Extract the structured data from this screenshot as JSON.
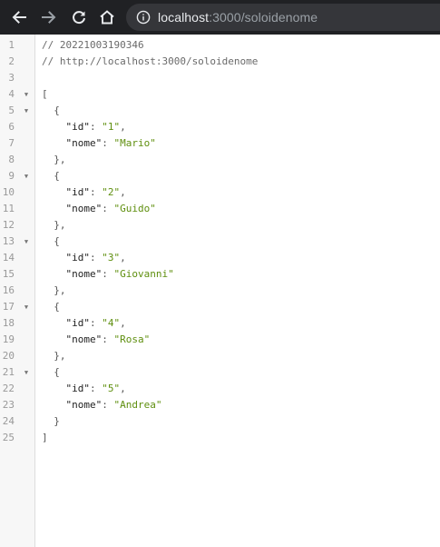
{
  "browser": {
    "url_host": "localhost",
    "url_rest": ":3000/soloidenome",
    "icons": {
      "back": "back-arrow-icon",
      "forward": "forward-arrow-icon",
      "reload": "reload-icon",
      "home": "home-icon",
      "info": "site-info-icon"
    }
  },
  "viewer": {
    "lines": [
      {
        "n": "1",
        "fold": "",
        "type": "comment",
        "indent": "",
        "text": "// 20221003190346"
      },
      {
        "n": "2",
        "fold": "",
        "type": "comment",
        "indent": "",
        "text": "// http://localhost:3000/soloidenome"
      },
      {
        "n": "3",
        "fold": "",
        "type": "blank",
        "indent": "",
        "text": ""
      },
      {
        "n": "4",
        "fold": "▼",
        "type": "punct",
        "indent": "",
        "text": "["
      },
      {
        "n": "5",
        "fold": "▼",
        "type": "punct",
        "indent": "  ",
        "text": "{"
      },
      {
        "n": "6",
        "fold": "",
        "type": "kv",
        "indent": "    ",
        "key": "\"id\"",
        "value": "\"1\"",
        "comma": true
      },
      {
        "n": "7",
        "fold": "",
        "type": "kv",
        "indent": "    ",
        "key": "\"nome\"",
        "value": "\"Mario\"",
        "comma": false
      },
      {
        "n": "8",
        "fold": "",
        "type": "punct",
        "indent": "  ",
        "text": "},"
      },
      {
        "n": "9",
        "fold": "▼",
        "type": "punct",
        "indent": "  ",
        "text": "{"
      },
      {
        "n": "10",
        "fold": "",
        "type": "kv",
        "indent": "    ",
        "key": "\"id\"",
        "value": "\"2\"",
        "comma": true
      },
      {
        "n": "11",
        "fold": "",
        "type": "kv",
        "indent": "    ",
        "key": "\"nome\"",
        "value": "\"Guido\"",
        "comma": false
      },
      {
        "n": "12",
        "fold": "",
        "type": "punct",
        "indent": "  ",
        "text": "},"
      },
      {
        "n": "13",
        "fold": "▼",
        "type": "punct",
        "indent": "  ",
        "text": "{"
      },
      {
        "n": "14",
        "fold": "",
        "type": "kv",
        "indent": "    ",
        "key": "\"id\"",
        "value": "\"3\"",
        "comma": true
      },
      {
        "n": "15",
        "fold": "",
        "type": "kv",
        "indent": "    ",
        "key": "\"nome\"",
        "value": "\"Giovanni\"",
        "comma": false
      },
      {
        "n": "16",
        "fold": "",
        "type": "punct",
        "indent": "  ",
        "text": "},"
      },
      {
        "n": "17",
        "fold": "▼",
        "type": "punct",
        "indent": "  ",
        "text": "{"
      },
      {
        "n": "18",
        "fold": "",
        "type": "kv",
        "indent": "    ",
        "key": "\"id\"",
        "value": "\"4\"",
        "comma": true
      },
      {
        "n": "19",
        "fold": "",
        "type": "kv",
        "indent": "    ",
        "key": "\"nome\"",
        "value": "\"Rosa\"",
        "comma": false
      },
      {
        "n": "20",
        "fold": "",
        "type": "punct",
        "indent": "  ",
        "text": "},"
      },
      {
        "n": "21",
        "fold": "▼",
        "type": "punct",
        "indent": "  ",
        "text": "{"
      },
      {
        "n": "22",
        "fold": "",
        "type": "kv",
        "indent": "    ",
        "key": "\"id\"",
        "value": "\"5\"",
        "comma": true
      },
      {
        "n": "23",
        "fold": "",
        "type": "kv",
        "indent": "    ",
        "key": "\"nome\"",
        "value": "\"Andrea\"",
        "comma": false
      },
      {
        "n": "24",
        "fold": "",
        "type": "punct",
        "indent": "  ",
        "text": "}"
      },
      {
        "n": "25",
        "fold": "",
        "type": "punct",
        "indent": "",
        "text": "]"
      }
    ]
  }
}
